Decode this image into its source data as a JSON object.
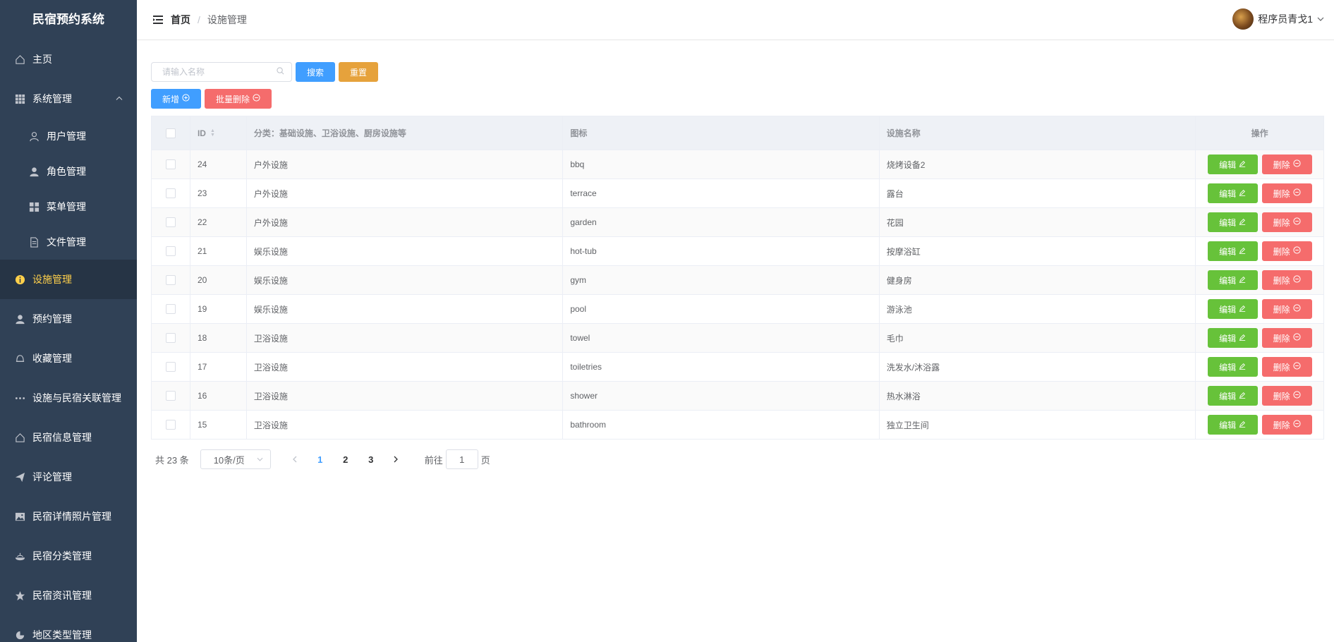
{
  "app": {
    "title": "民宿预约系统"
  },
  "sidebar": {
    "items": [
      {
        "label": "主页",
        "icon": "home-icon"
      },
      {
        "label": "系统管理",
        "icon": "grid-icon",
        "expanded": true
      },
      {
        "label": "用户管理",
        "icon": "user-icon",
        "sub": true
      },
      {
        "label": "角色管理",
        "icon": "user-filled-icon",
        "sub": true
      },
      {
        "label": "菜单管理",
        "icon": "menu-icon",
        "sub": true
      },
      {
        "label": "文件管理",
        "icon": "document-icon",
        "sub": true
      },
      {
        "label": "设施管理",
        "icon": "info-icon",
        "active": true
      },
      {
        "label": "预约管理",
        "icon": "user-filled-icon"
      },
      {
        "label": "收藏管理",
        "icon": "bell-icon"
      },
      {
        "label": "设施与民宿关联管理",
        "icon": "more-icon"
      },
      {
        "label": "民宿信息管理",
        "icon": "home-icon"
      },
      {
        "label": "评论管理",
        "icon": "send-icon"
      },
      {
        "label": "民宿详情照片管理",
        "icon": "picture-icon"
      },
      {
        "label": "民宿分类管理",
        "icon": "dish-icon"
      },
      {
        "label": "民宿资讯管理",
        "icon": "star-icon"
      },
      {
        "label": "地区类型管理",
        "icon": "pie-icon"
      }
    ]
  },
  "header": {
    "breadcrumb": {
      "home": "首页",
      "separator": "/",
      "current": "设施管理"
    },
    "user": {
      "name": "程序员青戈1"
    }
  },
  "toolbar": {
    "search_placeholder": "请输入名称",
    "search_label": "搜索",
    "reset_label": "重置",
    "add_label": "新增",
    "batch_delete_label": "批量删除"
  },
  "table": {
    "columns": {
      "id": "ID",
      "category": "分类：基础设施、卫浴设施、厨房设施等",
      "icon": "图标",
      "name": "设施名称",
      "operation": "操作"
    },
    "edit_label": "编辑",
    "delete_label": "删除",
    "rows": [
      {
        "id": "24",
        "category": "户外设施",
        "icon": "bbq",
        "name": "烧烤设备2"
      },
      {
        "id": "23",
        "category": "户外设施",
        "icon": "terrace",
        "name": "露台"
      },
      {
        "id": "22",
        "category": "户外设施",
        "icon": "garden",
        "name": "花园"
      },
      {
        "id": "21",
        "category": "娱乐设施",
        "icon": "hot-tub",
        "name": "按摩浴缸"
      },
      {
        "id": "20",
        "category": "娱乐设施",
        "icon": "gym",
        "name": "健身房"
      },
      {
        "id": "19",
        "category": "娱乐设施",
        "icon": "pool",
        "name": "游泳池"
      },
      {
        "id": "18",
        "category": "卫浴设施",
        "icon": "towel",
        "name": "毛巾"
      },
      {
        "id": "17",
        "category": "卫浴设施",
        "icon": "toiletries",
        "name": "洗发水/沐浴露"
      },
      {
        "id": "16",
        "category": "卫浴设施",
        "icon": "shower",
        "name": "热水淋浴"
      },
      {
        "id": "15",
        "category": "卫浴设施",
        "icon": "bathroom",
        "name": "独立卫生间"
      }
    ]
  },
  "pagination": {
    "total": "共 23 条",
    "page_size": "10条/页",
    "pages": [
      "1",
      "2",
      "3"
    ],
    "current_page": "1",
    "goto_label": "前往",
    "goto_value": "1",
    "page_unit": "页"
  },
  "colors": {
    "sidebar_bg": "#304156",
    "active_text": "#ffd04b",
    "primary": "#409eff",
    "warning": "#e6a23c",
    "danger": "#f56c6c",
    "success": "#67c23a"
  }
}
